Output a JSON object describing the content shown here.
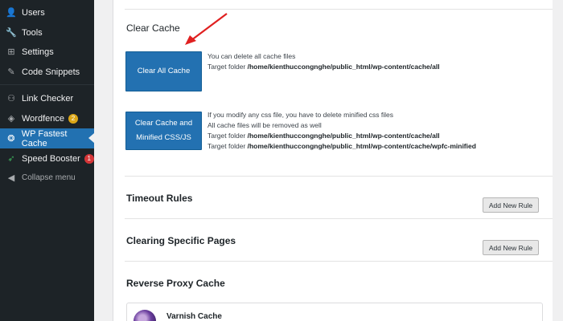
{
  "sidebar": {
    "items": [
      {
        "label": "Users",
        "icon": "users-icon",
        "glyph": "👤"
      },
      {
        "label": "Tools",
        "icon": "wrench-icon",
        "glyph": "🔧"
      },
      {
        "label": "Settings",
        "icon": "settings-icon",
        "glyph": "⊞"
      },
      {
        "label": "Code Snippets",
        "icon": "code-snippets-icon",
        "glyph": "✎"
      },
      {
        "label": "Link Checker",
        "icon": "link-icon",
        "glyph": "⚇"
      },
      {
        "label": "Wordfence",
        "icon": "wordfence-icon",
        "glyph": "◈",
        "badge": "2"
      },
      {
        "label": "WP Fastest Cache",
        "icon": "cheetah-icon",
        "glyph": "❂"
      },
      {
        "label": "Speed Booster",
        "icon": "rocket-icon",
        "glyph": "➶",
        "badge": "1"
      },
      {
        "label": "Collapse menu",
        "icon": "collapse-icon",
        "glyph": "◀"
      }
    ]
  },
  "clear_cache": {
    "title": "Clear Cache",
    "clear_all_button": "Clear All Cache",
    "clear_all_desc_1": "You can delete all cache files",
    "target_label": "Target folder",
    "clear_all_target": "/home/kienthuccongnghe/public_html/wp-content/cache/all",
    "clear_minified_button_line1": "Clear Cache and",
    "clear_minified_button_line2": "Minified CSS/JS",
    "clear_minified_desc_1": "If you modify any css file, you have to delete minified css files",
    "clear_minified_desc_2": "All cache files will be removed as well",
    "clear_minified_target_1": "/home/kienthuccongnghe/public_html/wp-content/cache/all",
    "clear_minified_target_2": "/home/kienthuccongnghe/public_html/wp-content/cache/wpfc-minified"
  },
  "timeout_rules": {
    "title": "Timeout Rules",
    "add_button": "Add New Rule"
  },
  "clearing_specific_pages": {
    "title": "Clearing Specific Pages",
    "add_button": "Add New Rule"
  },
  "reverse_proxy": {
    "title": "Reverse Proxy Cache",
    "varnish_title": "Varnish Cache"
  },
  "colors": {
    "sidebar_bg": "#1d2327",
    "active_bg": "#2271b1",
    "button_blue": "#2371b1",
    "arrow_red": "#e02020"
  }
}
